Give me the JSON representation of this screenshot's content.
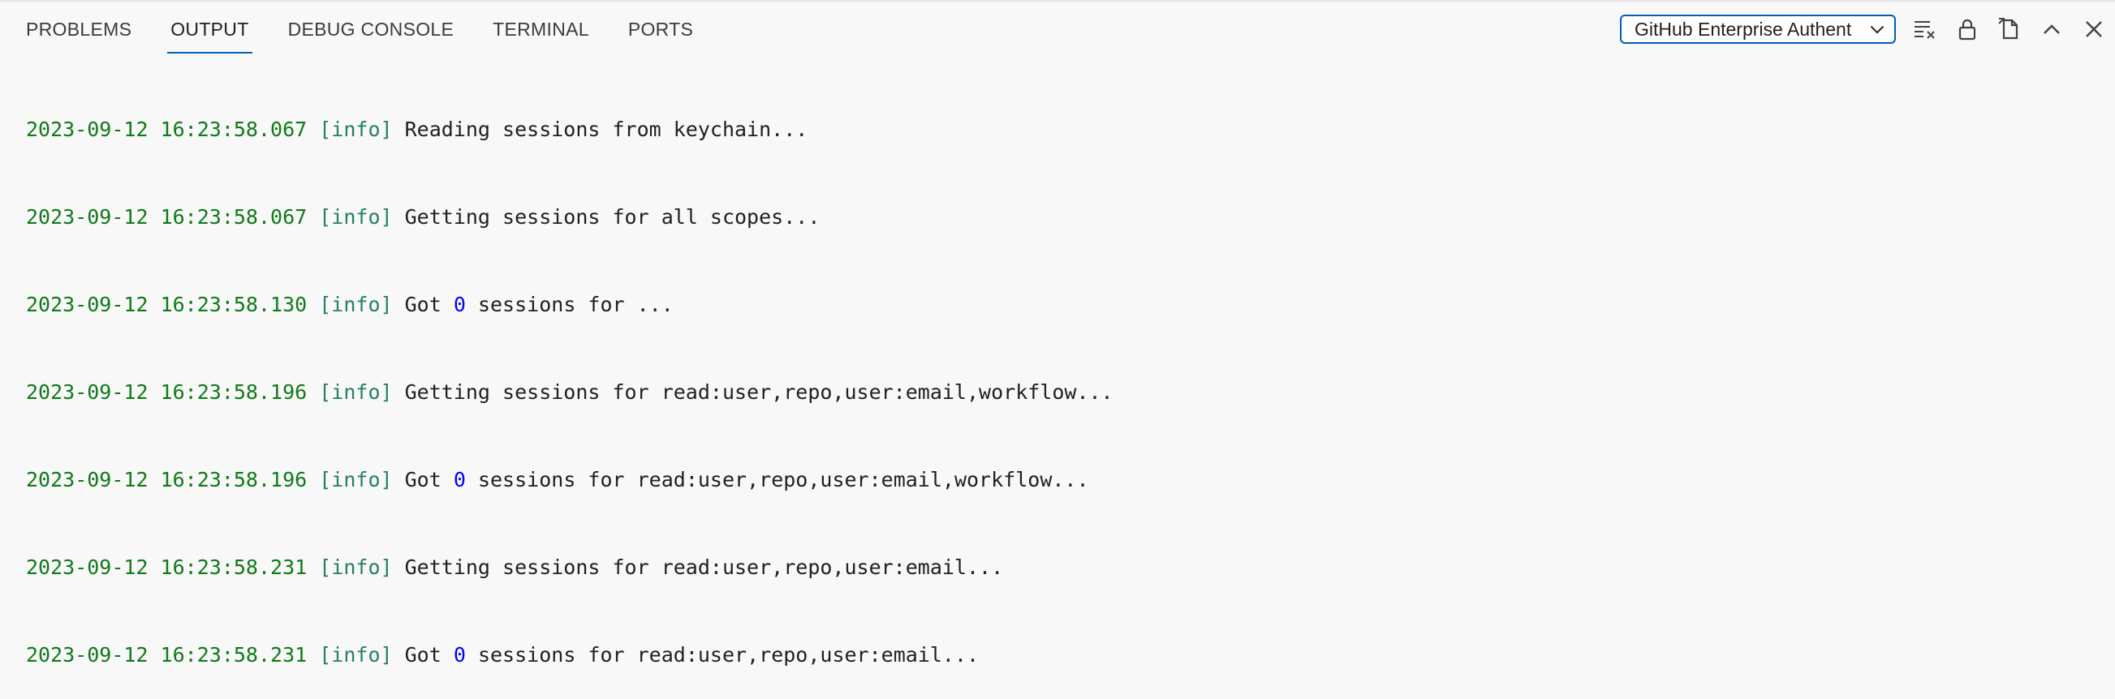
{
  "panel": {
    "tabs": [
      {
        "label": "PROBLEMS",
        "active": false
      },
      {
        "label": "OUTPUT",
        "active": true
      },
      {
        "label": "DEBUG CONSOLE",
        "active": false
      },
      {
        "label": "TERMINAL",
        "active": false
      },
      {
        "label": "PORTS",
        "active": false
      }
    ],
    "channel_select": {
      "selected": "GitHub Enterprise Authent"
    },
    "action_icons": [
      "clear-output-icon",
      "lock-scroll-icon",
      "open-output-in-editor-icon",
      "maximize-panel-icon",
      "close-panel-icon"
    ]
  },
  "output": {
    "lines": [
      {
        "timestamp": "2023-09-12 16:23:58.067",
        "level": "[info]",
        "pre": "Reading sessions from keychain...",
        "num": "",
        "post": ""
      },
      {
        "timestamp": "2023-09-12 16:23:58.067",
        "level": "[info]",
        "pre": "Getting sessions for all scopes...",
        "num": "",
        "post": ""
      },
      {
        "timestamp": "2023-09-12 16:23:58.130",
        "level": "[info]",
        "pre": "Got ",
        "num": "0",
        "post": " sessions for ..."
      },
      {
        "timestamp": "2023-09-12 16:23:58.196",
        "level": "[info]",
        "pre": "Getting sessions for read:user,repo,user:email,workflow...",
        "num": "",
        "post": ""
      },
      {
        "timestamp": "2023-09-12 16:23:58.196",
        "level": "[info]",
        "pre": "Got ",
        "num": "0",
        "post": " sessions for read:user,repo,user:email,workflow..."
      },
      {
        "timestamp": "2023-09-12 16:23:58.231",
        "level": "[info]",
        "pre": "Getting sessions for read:user,repo,user:email...",
        "num": "",
        "post": ""
      },
      {
        "timestamp": "2023-09-12 16:23:58.231",
        "level": "[info]",
        "pre": "Got ",
        "num": "0",
        "post": " sessions for read:user,repo,user:email..."
      }
    ]
  },
  "colors": {
    "accent": "#005fb8",
    "timestamp": "#0f7a18",
    "level": "#267f66",
    "number": "#0000ff",
    "background": "#f8f8f8"
  }
}
